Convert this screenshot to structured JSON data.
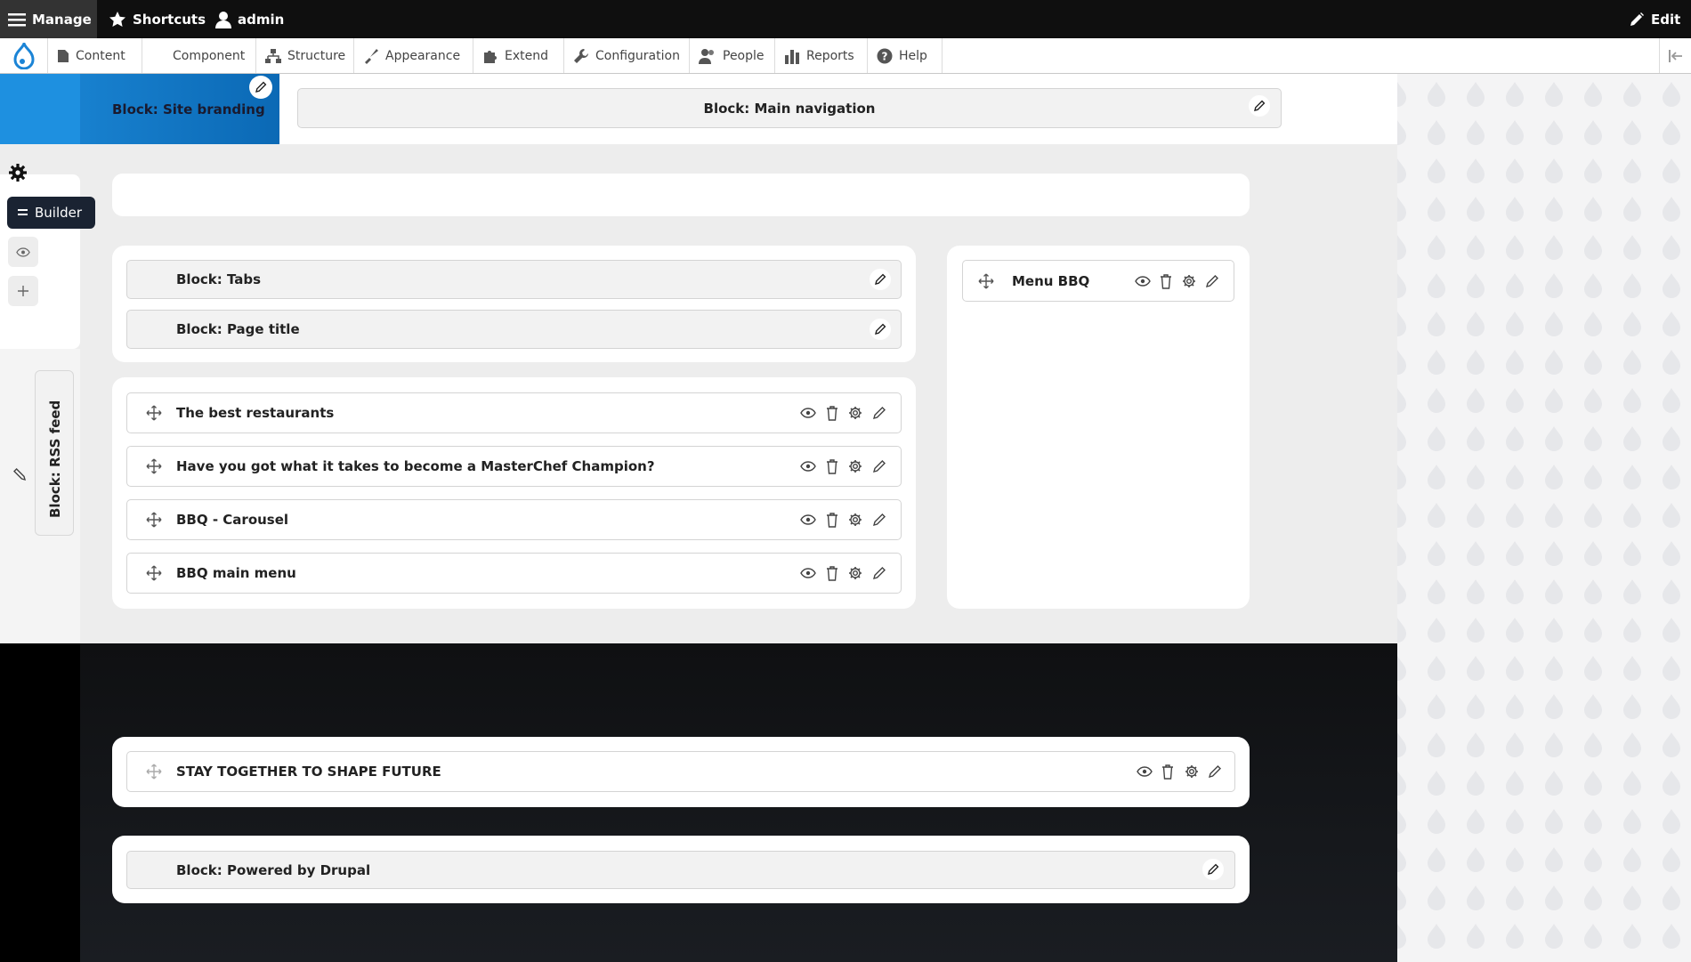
{
  "topbar": {
    "manage": "Manage",
    "shortcuts": "Shortcuts",
    "user": "admin",
    "edit": "Edit"
  },
  "toolbar": {
    "items": [
      {
        "label": "Content",
        "icon": "file-icon"
      },
      {
        "label": "Component",
        "icon": ""
      },
      {
        "label": "Structure",
        "icon": "structure-icon"
      },
      {
        "label": "Appearance",
        "icon": "paintbrush-icon"
      },
      {
        "label": "Extend",
        "icon": "puzzle-icon"
      },
      {
        "label": "Configuration",
        "icon": "wrench-icon"
      },
      {
        "label": "People",
        "icon": "people-icon"
      },
      {
        "label": "Reports",
        "icon": "bar-chart-icon"
      },
      {
        "label": "Help",
        "icon": "help-icon"
      }
    ]
  },
  "header": {
    "site_branding": "Block: Site branding",
    "main_navigation": "Block: Main navigation"
  },
  "sidepanel": {
    "builder_label": "Builder",
    "rss_feed": "Block: RSS feed"
  },
  "content": {
    "tabs": "Block: Tabs",
    "page_title": "Block: Page title",
    "rows": [
      "The best restaurants",
      "Have you got what it takes to become a MasterChef Champion?",
      "BBQ - Carousel",
      "BBQ main menu"
    ],
    "sidebar_block": "Menu BBQ"
  },
  "footer": {
    "stay_together": "STAY TOGETHER TO SHAPE FUTURE",
    "powered_by": "Block: Powered by Drupal"
  },
  "colors": {
    "accent_blue": "#1d8ad9",
    "dark": "#0f0f0f",
    "builder_bg": "#1a2332"
  }
}
